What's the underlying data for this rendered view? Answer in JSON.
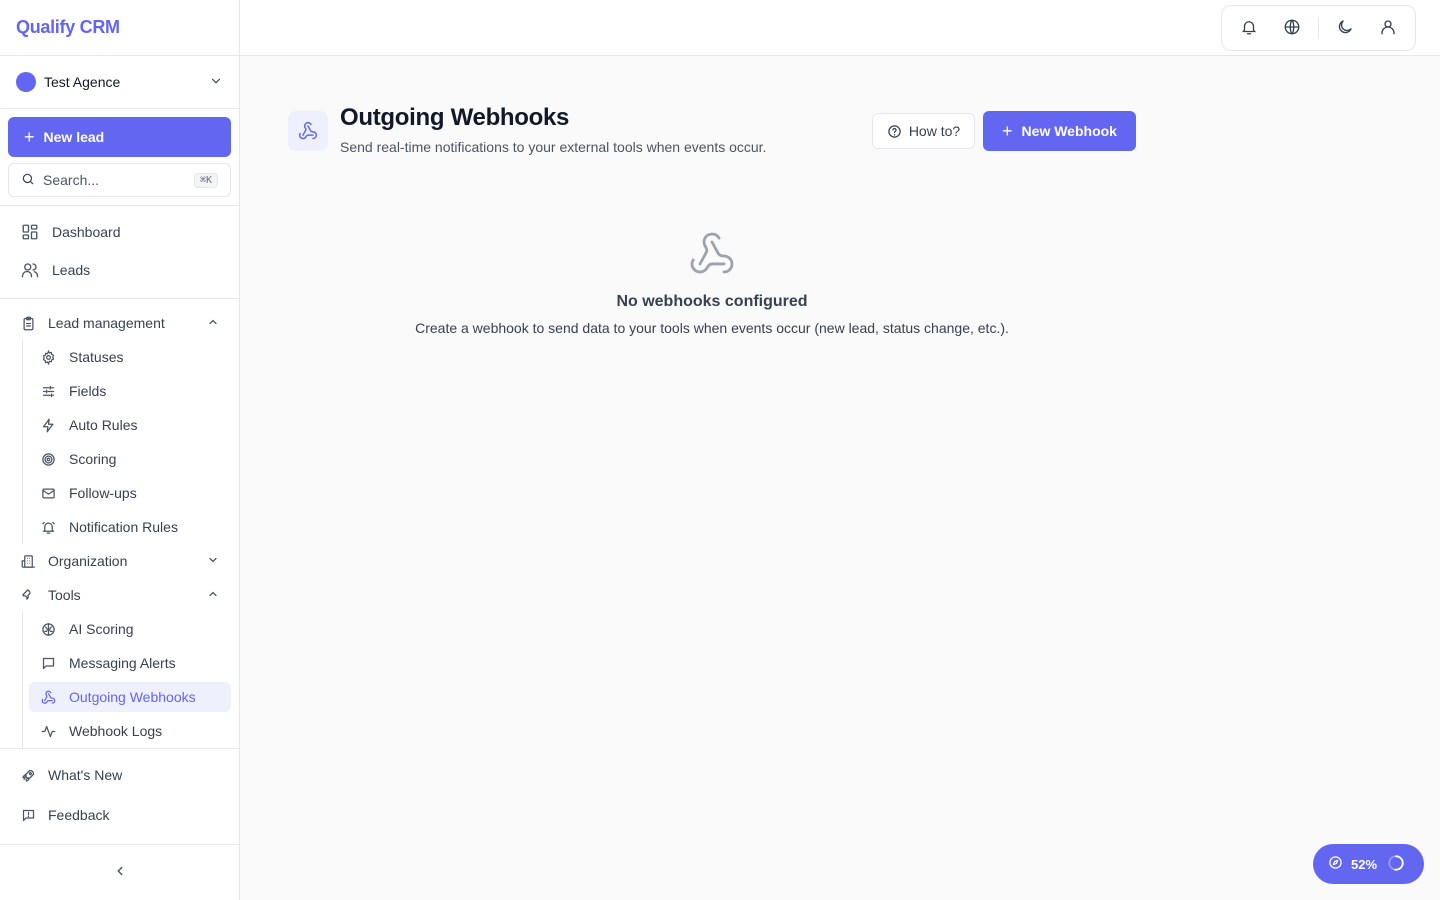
{
  "app": {
    "name": "Qualify CRM"
  },
  "org": {
    "name": "Test Agence"
  },
  "sidebar": {
    "new_lead_label": "New lead",
    "search_placeholder": "Search...",
    "search_shortcut": "⌘K",
    "primary": [
      {
        "label": "Dashboard",
        "icon": "dashboard-icon"
      },
      {
        "label": "Leads",
        "icon": "users-icon"
      }
    ],
    "sections": {
      "lead_management": {
        "label": "Lead management",
        "expanded": true,
        "items": [
          {
            "label": "Statuses",
            "icon": "gear-icon"
          },
          {
            "label": "Fields",
            "icon": "sliders-icon"
          },
          {
            "label": "Auto Rules",
            "icon": "lightning-icon"
          },
          {
            "label": "Scoring",
            "icon": "target-icon"
          },
          {
            "label": "Follow-ups",
            "icon": "mail-icon"
          },
          {
            "label": "Notification Rules",
            "icon": "bell-ring-icon"
          }
        ]
      },
      "organization": {
        "label": "Organization",
        "expanded": false
      },
      "tools": {
        "label": "Tools",
        "expanded": true,
        "items": [
          {
            "label": "AI Scoring",
            "icon": "brain-icon"
          },
          {
            "label": "Messaging Alerts",
            "icon": "message-icon"
          },
          {
            "label": "Outgoing Webhooks",
            "icon": "webhook-icon",
            "active": true
          },
          {
            "label": "Webhook Logs",
            "icon": "activity-icon"
          }
        ]
      }
    },
    "footer": [
      {
        "label": "What's New",
        "icon": "rocket-icon"
      },
      {
        "label": "Feedback",
        "icon": "feedback-icon"
      }
    ]
  },
  "page": {
    "title": "Outgoing Webhooks",
    "subtitle": "Send real-time notifications to your external tools when events occur.",
    "how_to_label": "How to?",
    "new_webhook_label": "New Webhook"
  },
  "empty_state": {
    "title": "No webhooks configured",
    "description": "Create a webhook to send data to your tools when events occur (new lead, status change, etc.)."
  },
  "progress_widget": {
    "label": "52%",
    "value": 0.52
  },
  "colors": {
    "accent": "#6366f1",
    "accent_soft": "#eef0fd",
    "border": "#e5e7eb"
  }
}
